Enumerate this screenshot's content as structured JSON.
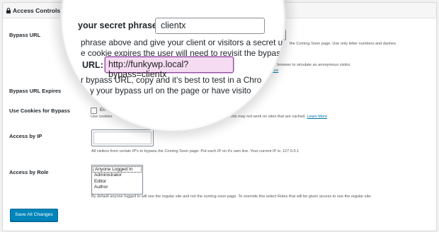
{
  "panel": {
    "title": "Access Controls",
    "rows": {
      "bypass_url": {
        "label": "Bypass URL"
      },
      "bypass_url_expires": {
        "label": "Bypass URL Expires"
      },
      "use_cookies": {
        "label": "Use Cookies for Bypass",
        "checkbox_text": "En",
        "note_left": "Use cookies",
        "note_right": "ote: this may not work on sites that are cached.",
        "link": "Learn More"
      },
      "access_by_ip": {
        "label": "Access by IP",
        "note": "All visitors from certain IP's to bypass the Coming Soon page. Put each IP on it's own line. Your current IP is: 127.0.0.1"
      },
      "access_by_role": {
        "label": "Access by Role",
        "options": [
          "Anyone Logged In",
          "Administrator",
          "Editor",
          "Author"
        ],
        "note": "By default anyone logged in will see the regular site and not the coming soon page. To override this select Roles that will be given access to see the regular site."
      }
    },
    "bypass_note_right": "the Coming Soon page. Use only letter numbers and dashes.",
    "bypass_url_note_right": "parate browser to simulate an anonymous visitor.",
    "bypass_url_link": "rn More",
    "save_button": "Save All Changes"
  },
  "magnifier": {
    "phrase_label": "your secret phrase:",
    "phrase_value": "clientx",
    "line1": "phrase above and give your client or visitors a secret url th",
    "line2": "e cookie expires the user will need to revisit the bypass u",
    "url_label": "URL:",
    "url_value": "http://funkywp.local?bypass=clientx",
    "line3": "r bypass URL, copy and it's best to test in a Chro",
    "line4": "y your bypass url on the page or have visito"
  }
}
